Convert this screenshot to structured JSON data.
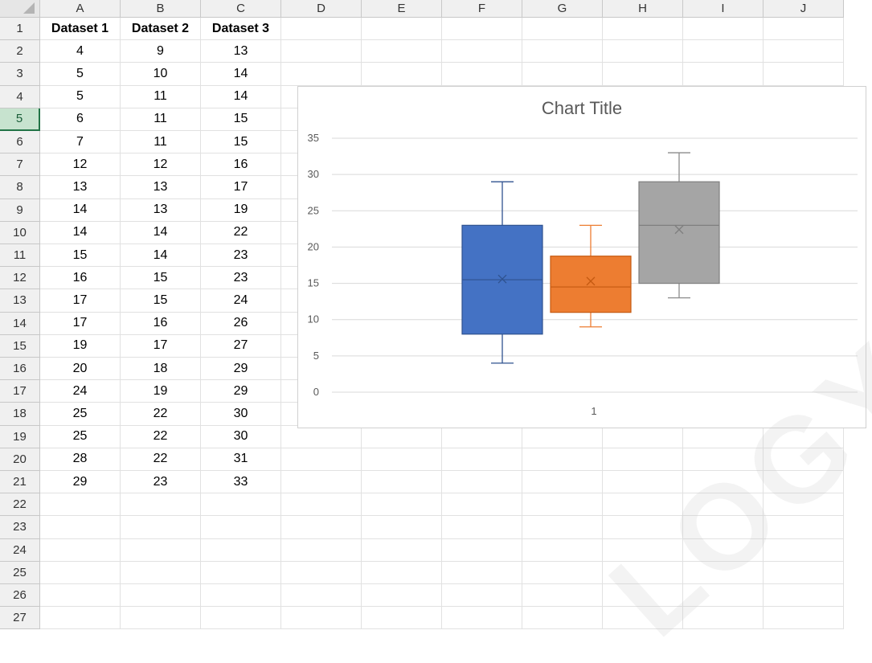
{
  "sheet": {
    "columns": [
      "A",
      "B",
      "C",
      "D",
      "E",
      "F",
      "G",
      "H",
      "I",
      "J"
    ],
    "rows": [
      "1",
      "2",
      "3",
      "4",
      "5",
      "6",
      "7",
      "8",
      "9",
      "10",
      "11",
      "12",
      "13",
      "14",
      "15",
      "16",
      "17",
      "18",
      "19",
      "20",
      "21",
      "22",
      "23",
      "24",
      "25",
      "26",
      "27"
    ],
    "active_row": "5",
    "headers": [
      "Dataset 1",
      "Dataset 2",
      "Dataset 3"
    ],
    "values": [
      [
        "4",
        "9",
        "13"
      ],
      [
        "5",
        "10",
        "14"
      ],
      [
        "5",
        "11",
        "14"
      ],
      [
        "6",
        "11",
        "15"
      ],
      [
        "7",
        "11",
        "15"
      ],
      [
        "12",
        "12",
        "16"
      ],
      [
        "13",
        "13",
        "17"
      ],
      [
        "14",
        "13",
        "19"
      ],
      [
        "14",
        "14",
        "22"
      ],
      [
        "15",
        "14",
        "23"
      ],
      [
        "16",
        "15",
        "23"
      ],
      [
        "17",
        "15",
        "24"
      ],
      [
        "17",
        "16",
        "26"
      ],
      [
        "19",
        "17",
        "27"
      ],
      [
        "20",
        "18",
        "29"
      ],
      [
        "24",
        "19",
        "29"
      ],
      [
        "25",
        "22",
        "30"
      ],
      [
        "25",
        "22",
        "30"
      ],
      [
        "28",
        "22",
        "31"
      ],
      [
        "29",
        "23",
        "33"
      ]
    ]
  },
  "chart_data": {
    "type": "box",
    "title": "Chart Title",
    "categories": [
      "1"
    ],
    "ylim": [
      0,
      35
    ],
    "yticks": [
      "0",
      "5",
      "10",
      "15",
      "20",
      "25",
      "30",
      "35"
    ],
    "grid": true,
    "series": [
      {
        "color": "#4472c4",
        "min": 4,
        "q1": 8,
        "median": 15.5,
        "q3": 23,
        "max": 29,
        "mean": 15.6
      },
      {
        "color": "#ed7d31",
        "min": 9,
        "q1": 11,
        "median": 14.5,
        "q3": 18.75,
        "max": 23,
        "mean": 15.3
      },
      {
        "color": "#a5a5a5",
        "min": 13,
        "q1": 15,
        "median": 23,
        "q3": 29,
        "max": 33,
        "mean": 22.4
      }
    ]
  },
  "watermark": {
    "text": "LOGY.CO"
  }
}
